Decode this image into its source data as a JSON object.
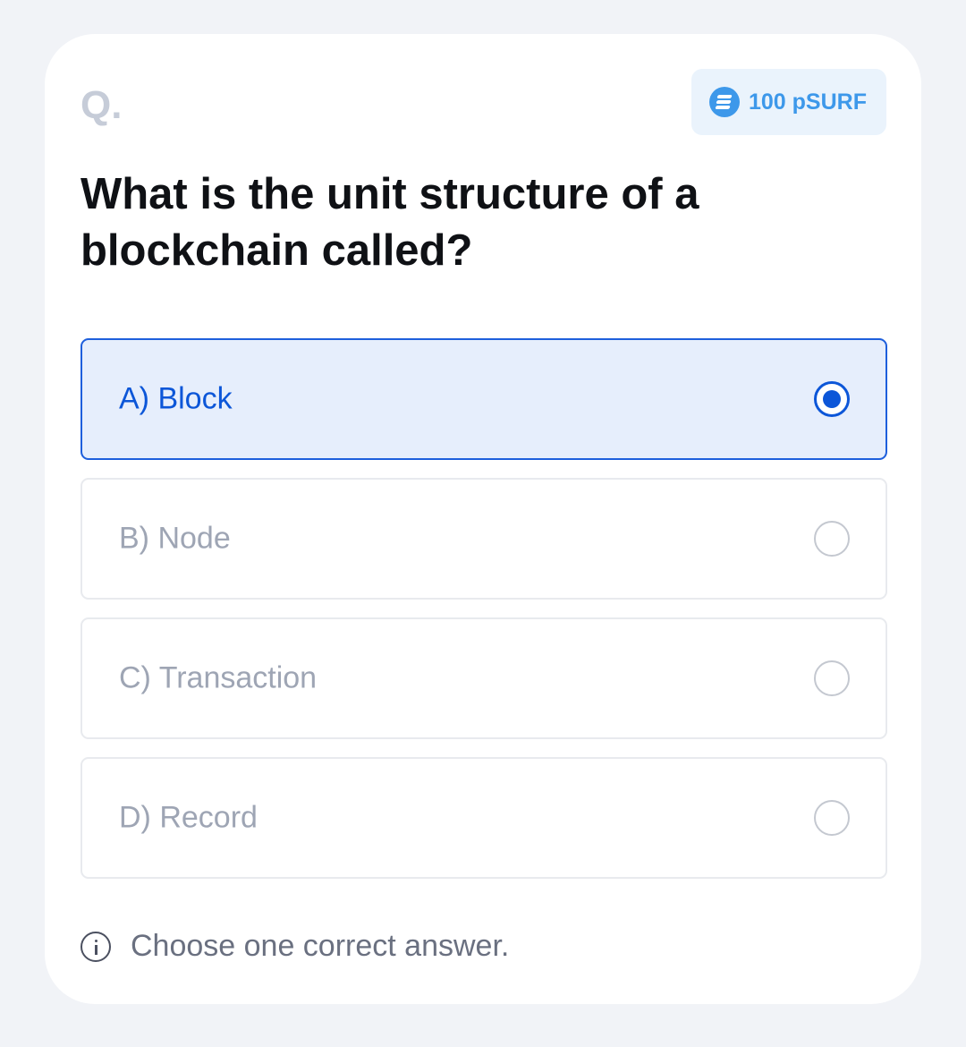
{
  "question": {
    "label": "Q.",
    "text": "What is the unit structure of a blockchain called?"
  },
  "reward": {
    "icon": "coin-icon",
    "amount": "100 pSURF",
    "accent_color": "#3d98ea"
  },
  "options": [
    {
      "label": "A) Block",
      "selected": true
    },
    {
      "label": "B) Node",
      "selected": false
    },
    {
      "label": "C) Transaction",
      "selected": false
    },
    {
      "label": "D) Record",
      "selected": false
    }
  ],
  "hint": {
    "icon": "info-icon",
    "text": "Choose one correct answer."
  },
  "colors": {
    "selected_border": "#1e5fdc",
    "selected_bg": "#e6eefc",
    "selected_text": "#0c56d8"
  }
}
